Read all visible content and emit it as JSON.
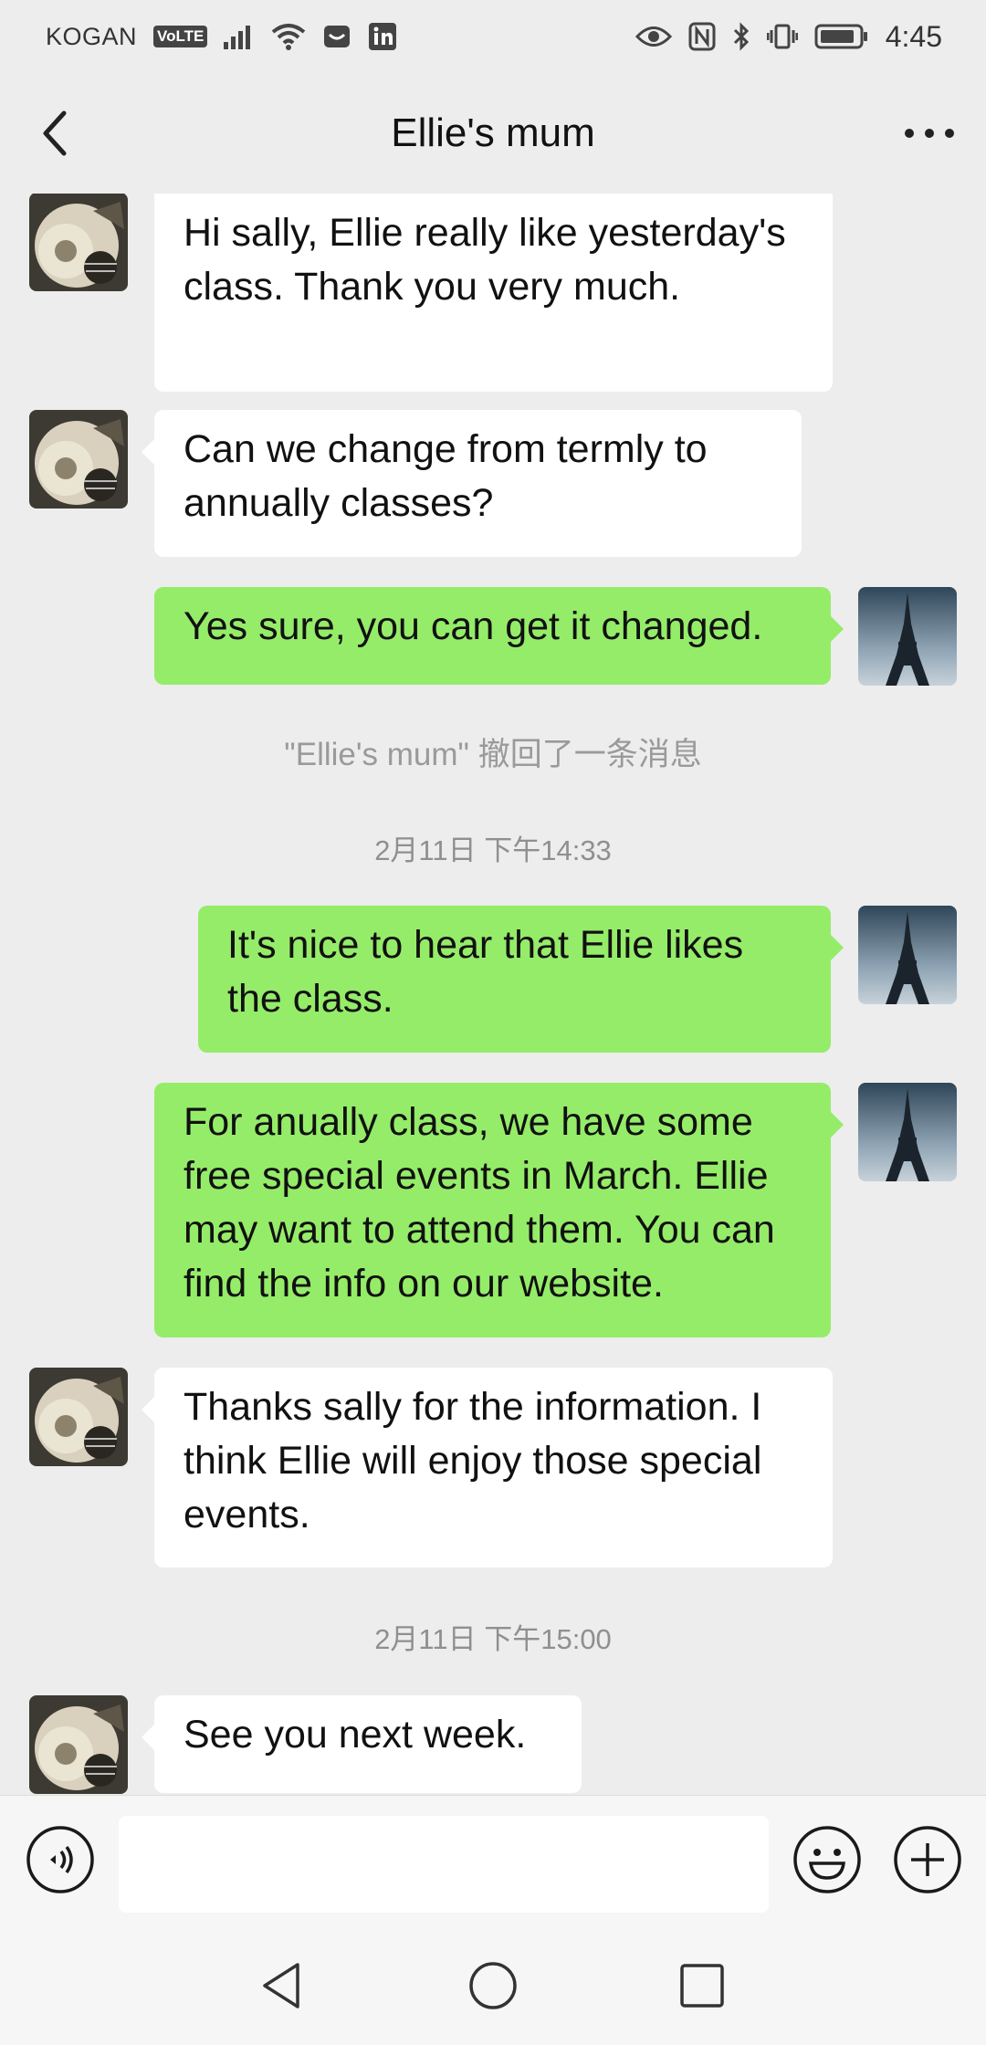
{
  "status_bar": {
    "carrier": "KOGAN",
    "volte": "VoLTE",
    "time": "4:45"
  },
  "header": {
    "title": "Ellie's mum"
  },
  "messages": [
    {
      "side": "in",
      "text": "Hi sally, Ellie really like yesterday's class. Thank you very much."
    },
    {
      "side": "in",
      "text": "Can we change from termly to annually classes?"
    },
    {
      "side": "out",
      "text": "Yes sure, you can get it changed."
    },
    {
      "type": "recall",
      "text": "\"Ellie's mum\" 撤回了一条消息"
    },
    {
      "type": "timestamp",
      "text": "2月11日 下午14:33"
    },
    {
      "side": "out",
      "text": "It's nice to hear that Ellie likes the class."
    },
    {
      "side": "out",
      "text": "For anually class, we have some free special events in March. Ellie may want to attend them. You can find the info on our website."
    },
    {
      "side": "in",
      "text": "Thanks sally for the information. I think Ellie will enjoy those special events."
    },
    {
      "type": "timestamp",
      "text": "2月11日 下午15:00"
    },
    {
      "side": "in",
      "text": "See you next week."
    }
  ],
  "input": {
    "value": "",
    "placeholder": ""
  },
  "colors": {
    "background": "#ededed",
    "incoming_bubble": "#ffffff",
    "outgoing_bubble": "#95ec69",
    "system_text": "#9a9a9a"
  },
  "icons": {
    "back": "chevron-left-icon",
    "more": "more-dots-icon",
    "voice": "voice-icon",
    "emoji": "emoji-icon",
    "plus": "plus-icon",
    "nav_back": "triangle-back-icon",
    "nav_home": "circle-home-icon",
    "nav_recent": "square-recent-icon"
  }
}
